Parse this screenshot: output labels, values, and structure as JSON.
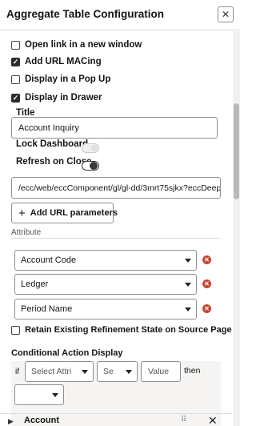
{
  "header": {
    "title": "Aggregate Table Configuration"
  },
  "options": [
    {
      "label": "Open link in a new window",
      "checked": false
    },
    {
      "label": "Add URL MACing",
      "checked": true
    },
    {
      "label": "Display in a Pop Up",
      "checked": false
    },
    {
      "label": "Display in Drawer",
      "checked": true
    }
  ],
  "title_field": {
    "label": "Title",
    "value": "Account Inquiry"
  },
  "lock_dashboard": {
    "label": "Lock Dashboard",
    "on": false
  },
  "refresh_on_close": {
    "label": "Refresh on Close",
    "on": true
  },
  "url_field": {
    "value": "/ecc/web/eccComponent/gl/gl-dd/3mrt75sjkx?eccDeep"
  },
  "add_url_params": {
    "label": "Add URL parameters"
  },
  "attribute": {
    "label": "Attribute",
    "items": [
      "Account Code",
      "Ledger",
      "Period Name"
    ]
  },
  "retain_refinement": {
    "label": "Retain Existing Refinement State on Source Page",
    "checked": false
  },
  "conditional": {
    "label": "Conditional Action Display",
    "if_label": "if",
    "attribute_placeholder": "Select Attri",
    "operator_placeholder": "Se",
    "value_placeholder": "Value",
    "then_label": "then",
    "then_value": ""
  },
  "accordion": {
    "label": "Account"
  }
}
